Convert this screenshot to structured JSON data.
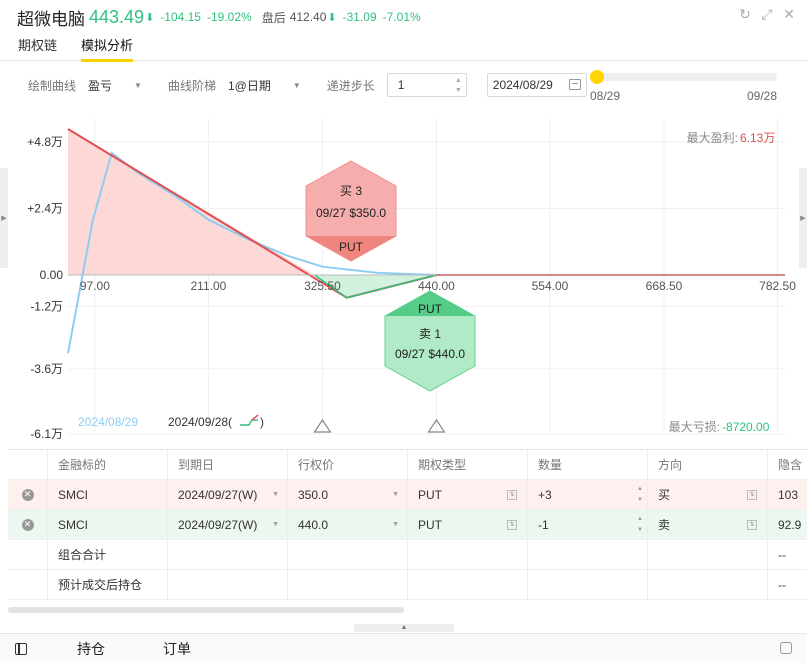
{
  "header": {
    "stock_name": "超微电脑",
    "price": "443.49",
    "change": "-104.15",
    "change_pct": "-19.02%",
    "after_hours_label": "盘后",
    "after_hours_price": "412.40",
    "after_hours_change": "-31.09",
    "after_hours_pct": "-7.01%",
    "icons": [
      "refresh-icon",
      "fullscreen-icon",
      "close-icon"
    ]
  },
  "tabs": [
    {
      "label": "期权链",
      "active": false
    },
    {
      "label": "模拟分析",
      "active": true
    }
  ],
  "controls": {
    "curve_label": "绘制曲线",
    "curve_value": "盈亏",
    "ladder_label": "曲线阶梯",
    "ladder_value": "1@日期",
    "step_label": "递进步长",
    "step_value": "1",
    "date_value": "2024/08/29",
    "slider_min": "08/29",
    "slider_max": "09/28",
    "slider_position": 0
  },
  "chart_data": {
    "type": "line",
    "x_ticks": [
      "97.00",
      "211.00",
      "325.50",
      "440.00",
      "554.00",
      "668.50",
      "782.50"
    ],
    "y_ticks": [
      "+4.8万",
      "+2.4万",
      "0.00",
      "-1.2万",
      "-3.6万",
      "-6.1万"
    ],
    "max_profit_label": "最大盈利:",
    "max_profit_value": "6.13万",
    "max_loss_label": "最大亏损:",
    "max_loss_value": "-8720.00",
    "series": [
      {
        "name": "2024/08/29",
        "color": "#8ecdf2",
        "points": [
          [
            70,
            -30000
          ],
          [
            95,
            20000
          ],
          [
            114,
            44000
          ],
          [
            140,
            37000
          ],
          [
            180,
            28000
          ],
          [
            211,
            20000
          ],
          [
            250,
            13000
          ],
          [
            290,
            7000
          ],
          [
            325.5,
            3000
          ],
          [
            380,
            800
          ],
          [
            440,
            0
          ],
          [
            790,
            0
          ]
        ]
      },
      {
        "name": "2024/09/28",
        "color": "#e05050",
        "points": [
          [
            70,
            52700
          ],
          [
            350,
            -8720
          ],
          [
            440,
            0
          ],
          [
            790,
            0
          ]
        ]
      }
    ],
    "legend": [
      {
        "label": "2024/08/29",
        "color": "#8ecdf2"
      },
      {
        "label": "2024/09/28(",
        "suffix": ")",
        "color": "#e05050"
      }
    ],
    "legs": [
      {
        "side": "买 3",
        "detail": "09/27 $350.0",
        "type": "PUT",
        "strike": 350,
        "color": "#f5a5a5",
        "band": "#f08580"
      },
      {
        "side": "卖 1",
        "detail": "09/27 $440.0",
        "type": "PUT",
        "strike": 440,
        "color": "#a9e8c2",
        "band": "#55cc88"
      }
    ],
    "ylim": [
      -61000,
      52700
    ],
    "xlim": [
      70,
      790
    ]
  },
  "table": {
    "headers": [
      "金融标的",
      "到期日",
      "行权价",
      "期权类型",
      "数量",
      "方向",
      "隐含"
    ],
    "rows": [
      {
        "symbol": "SMCI",
        "expiry": "2024/09/27(W)",
        "strike": "350.0",
        "type": "PUT",
        "qty": "+3",
        "direction": "买",
        "iv": "103",
        "kind": "buy"
      },
      {
        "symbol": "SMCI",
        "expiry": "2024/09/27(W)",
        "strike": "440.0",
        "type": "PUT",
        "qty": "-1",
        "direction": "卖",
        "iv": "92.9",
        "kind": "sell"
      }
    ],
    "summary_rows": [
      {
        "label": "组合合计",
        "iv": "--"
      },
      {
        "label": "预计成交后持仓",
        "iv": "--"
      }
    ]
  },
  "footer": {
    "tab1": "持仓",
    "tab2": "订单"
  }
}
